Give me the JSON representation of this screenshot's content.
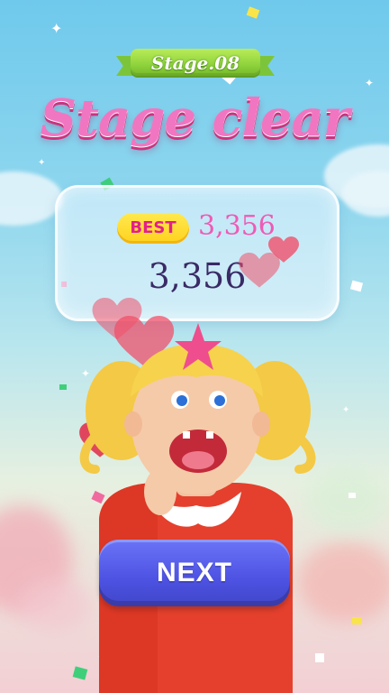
{
  "stage": {
    "label": "Stage.08"
  },
  "title": "Stage clear",
  "score_panel": {
    "best_label": "BEST",
    "best_score": "3,356",
    "score": "3,356"
  },
  "next_button": {
    "label": "NEXT"
  },
  "colors": {
    "title_pink": "#f176c1",
    "ribbon_green": "#8fd33c",
    "best_badge_yellow": "#ffd21f",
    "best_text_magenta": "#e3208b",
    "score_dark": "#3a2a66",
    "next_button_blue": "#4d52e2"
  }
}
